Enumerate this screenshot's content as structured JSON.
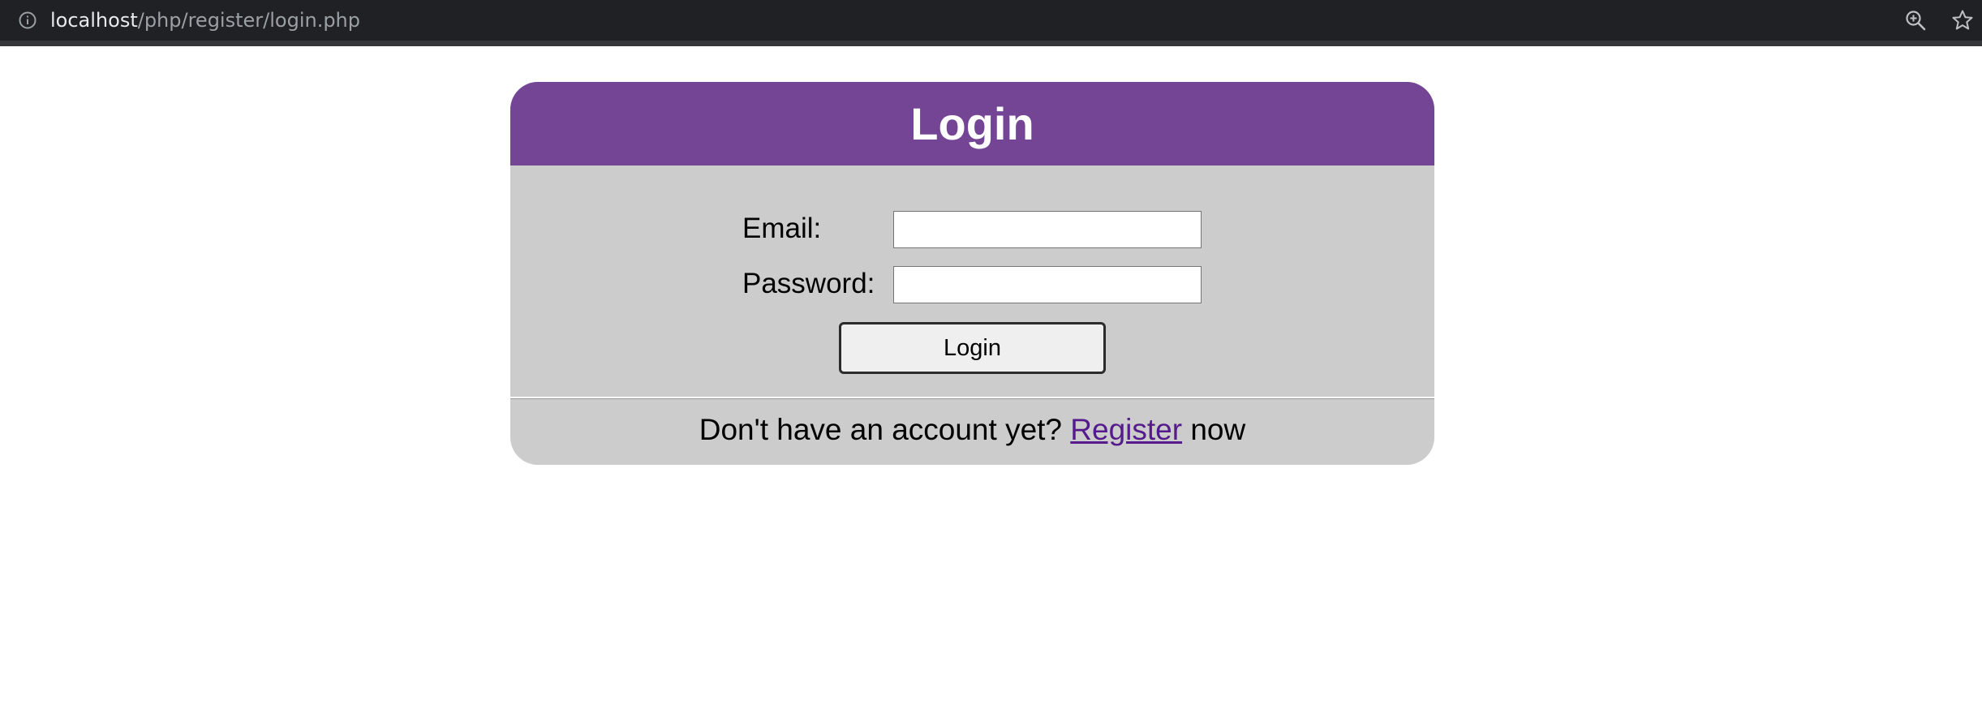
{
  "browser": {
    "url_host": "localhost",
    "url_path": "/php/register/login.php"
  },
  "card": {
    "title": "Login",
    "email_label": "Email:",
    "email_value": "",
    "password_label": "Password:",
    "password_value": "",
    "login_button_label": "Login",
    "footer_prefix": "Don't have an account yet? ",
    "register_link_label": "Register",
    "footer_suffix": " now"
  },
  "colors": {
    "header": "#734594",
    "card_background": "#cccccc",
    "link": "#551a8b",
    "browser_bar": "#202124"
  },
  "icons": {
    "site_info": "info-icon",
    "zoom": "zoom-in-icon",
    "bookmark": "star-icon"
  }
}
